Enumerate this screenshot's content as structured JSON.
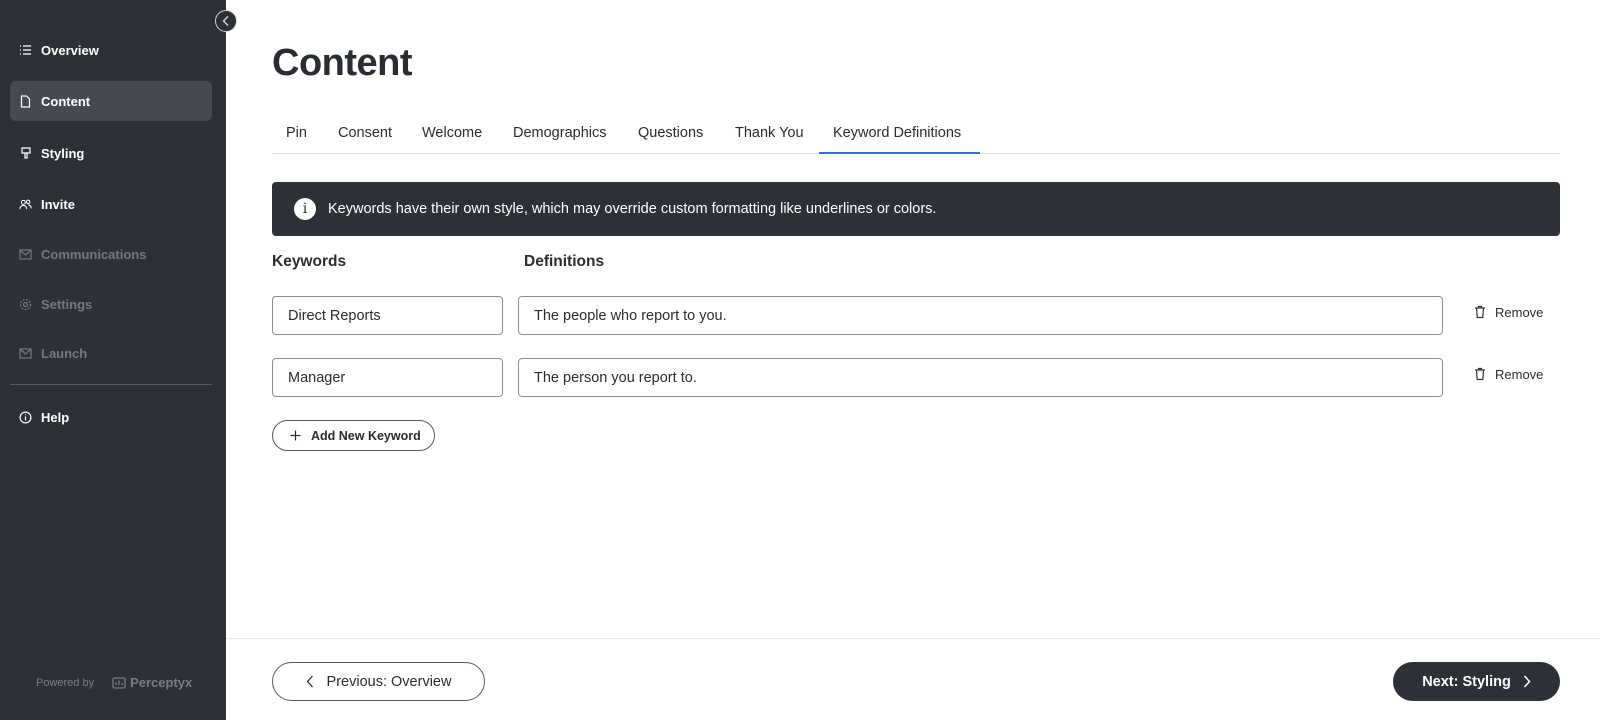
{
  "sidebar": {
    "items": [
      {
        "label": "Overview",
        "icon": "list-icon",
        "state": "normal"
      },
      {
        "label": "Content",
        "icon": "document-icon",
        "state": "active"
      },
      {
        "label": "Styling",
        "icon": "paint-brush-icon",
        "state": "normal"
      },
      {
        "label": "Invite",
        "icon": "users-icon",
        "state": "normal"
      },
      {
        "label": "Communications",
        "icon": "envelope-icon",
        "state": "disabled"
      },
      {
        "label": "Settings",
        "icon": "gear-icon",
        "state": "disabled"
      },
      {
        "label": "Launch",
        "icon": "envelope-icon",
        "state": "disabled"
      },
      {
        "label": "Help",
        "icon": "info-circle-icon",
        "state": "normal"
      }
    ],
    "powered_by": "Powered by",
    "brand": "Perceptyx"
  },
  "page": {
    "title": "Content"
  },
  "tabs": [
    {
      "label": "Pin",
      "active": false
    },
    {
      "label": "Consent",
      "active": false
    },
    {
      "label": "Welcome",
      "active": false
    },
    {
      "label": "Demographics",
      "active": false
    },
    {
      "label": "Questions",
      "active": false
    },
    {
      "label": "Thank You",
      "active": false
    },
    {
      "label": "Keyword Definitions",
      "active": true
    }
  ],
  "banner": {
    "text": "Keywords have their own style, which may override custom formatting like underlines or colors."
  },
  "table": {
    "keywords_header": "Keywords",
    "definitions_header": "Definitions",
    "rows": [
      {
        "keyword": "Direct Reports",
        "definition": "The people who report to you.",
        "remove_label": "Remove"
      },
      {
        "keyword": "Manager",
        "definition": "The person you report to.",
        "remove_label": "Remove"
      }
    ]
  },
  "add_button": {
    "label": "Add New Keyword"
  },
  "footer": {
    "prev_label": "Previous: Overview",
    "next_label": "Next: Styling"
  },
  "colors": {
    "sidebar_bg": "#2e3038",
    "active_tab": "#2f6fdc",
    "text": "#2a2c33"
  }
}
